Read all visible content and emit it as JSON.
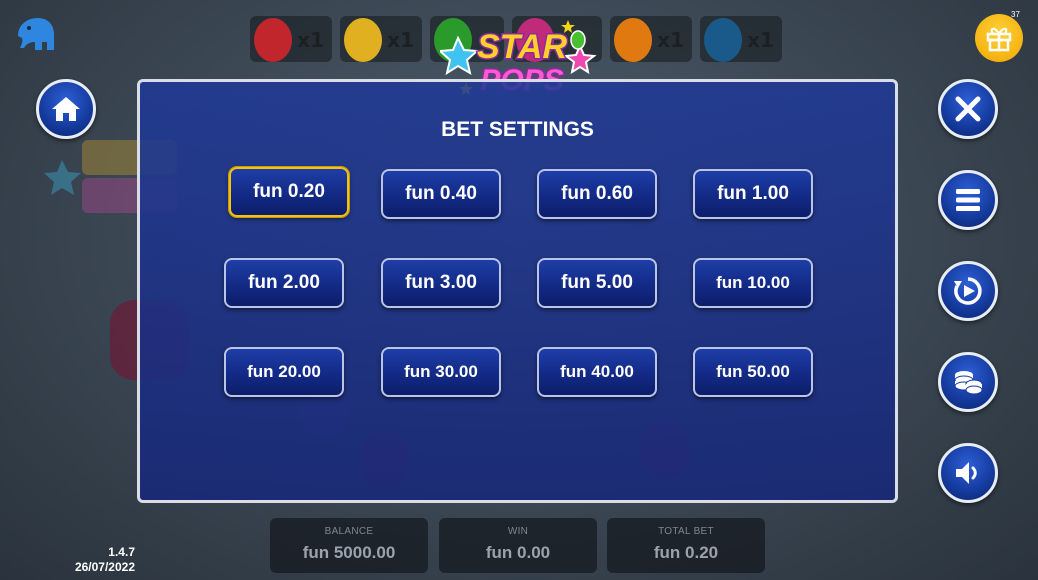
{
  "header": {
    "multipliers": [
      {
        "label": "x1",
        "color": "#c0262c"
      },
      {
        "label": "x1",
        "color": "#e0b020"
      },
      {
        "label": "x1",
        "color": "#2a9a2a"
      },
      {
        "label": "x1",
        "color": "#e07a10"
      },
      {
        "label": "x1",
        "color": "#1a5a8a"
      }
    ],
    "logo_text_1": "STAR",
    "logo_text_2": "POPS",
    "gift_count": "37"
  },
  "bet_settings": {
    "title": "BET SETTINGS",
    "selected": "fun 0.20",
    "options": [
      "fun 0.20",
      "fun 0.40",
      "fun 0.60",
      "fun 1.00",
      "fun 2.00",
      "fun 3.00",
      "fun 5.00",
      "fun 10.00",
      "fun 20.00",
      "fun 30.00",
      "fun 40.00",
      "fun 50.00"
    ]
  },
  "footer": {
    "balance_label": "BALANCE",
    "balance_value": "fun 5000.00",
    "win_label": "WIN",
    "win_value": "fun 0.00",
    "total_bet_label": "TOTAL BET",
    "total_bet_value": "fun 0.20",
    "version": "1.4.7",
    "date": "26/07/2022"
  },
  "icons": {
    "left": [
      "home-icon"
    ],
    "right": [
      "close-icon",
      "menu-icon",
      "autoplay-icon",
      "coins-icon",
      "sound-icon"
    ],
    "top_left": "elephant-logo-icon",
    "top_right": "gift-icon"
  },
  "colors": {
    "panel": "#1e3a96",
    "button": "#132a86",
    "selected_border": "#f2c214",
    "gift": "#f1a500"
  }
}
